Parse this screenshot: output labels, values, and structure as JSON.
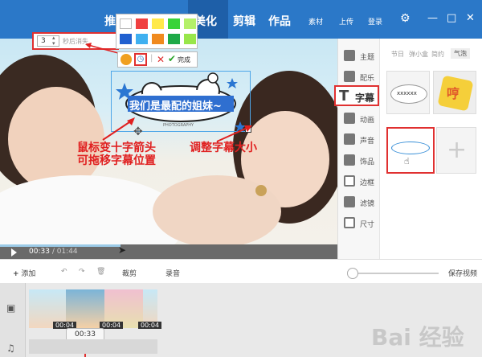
{
  "topbar": {
    "nav": [
      "推",
      "美化",
      "剪辑",
      "作品"
    ],
    "small": [
      "素材",
      "上传",
      "登录"
    ],
    "window": [
      "—",
      "□",
      "✕"
    ]
  },
  "duration_popup": {
    "value": "3",
    "label": "秒后消失"
  },
  "color_palette": [
    "#ffffff",
    "#f04040",
    "#ffe94a",
    "#39d339",
    "#b4f06a",
    "#2060d0",
    "#3fb0f0",
    "#f08a1e",
    "#1eaa48",
    "#98e64a"
  ],
  "subtitle_toolbar": {
    "done": "完成"
  },
  "caption": {
    "text": "我们是最配的姐妹~",
    "photo_tag": "PHOTOGRAPHY"
  },
  "annotations": {
    "move": [
      "鼠标变十字箭头",
      "可拖移字幕位置"
    ],
    "resize": "调整字幕大小"
  },
  "player": {
    "current": "00:33",
    "total": "/ 01:44"
  },
  "tools": [
    "主题",
    "配乐",
    "字幕",
    "动画",
    "声音",
    "饰品",
    "边框",
    "滤镜",
    "尺寸"
  ],
  "subtabs": [
    "节日",
    "弹小盒",
    "简约",
    "气泡"
  ],
  "bubble_text": "xxxxxx",
  "bubble_hint": "哼",
  "bottombar": {
    "add": "添加",
    "cut": "裁剪",
    "record": "录音",
    "save": "保存视频"
  },
  "timeline": {
    "clip_duration": "00:04",
    "playhead": "00:33"
  },
  "watermark": "Bai 经验"
}
